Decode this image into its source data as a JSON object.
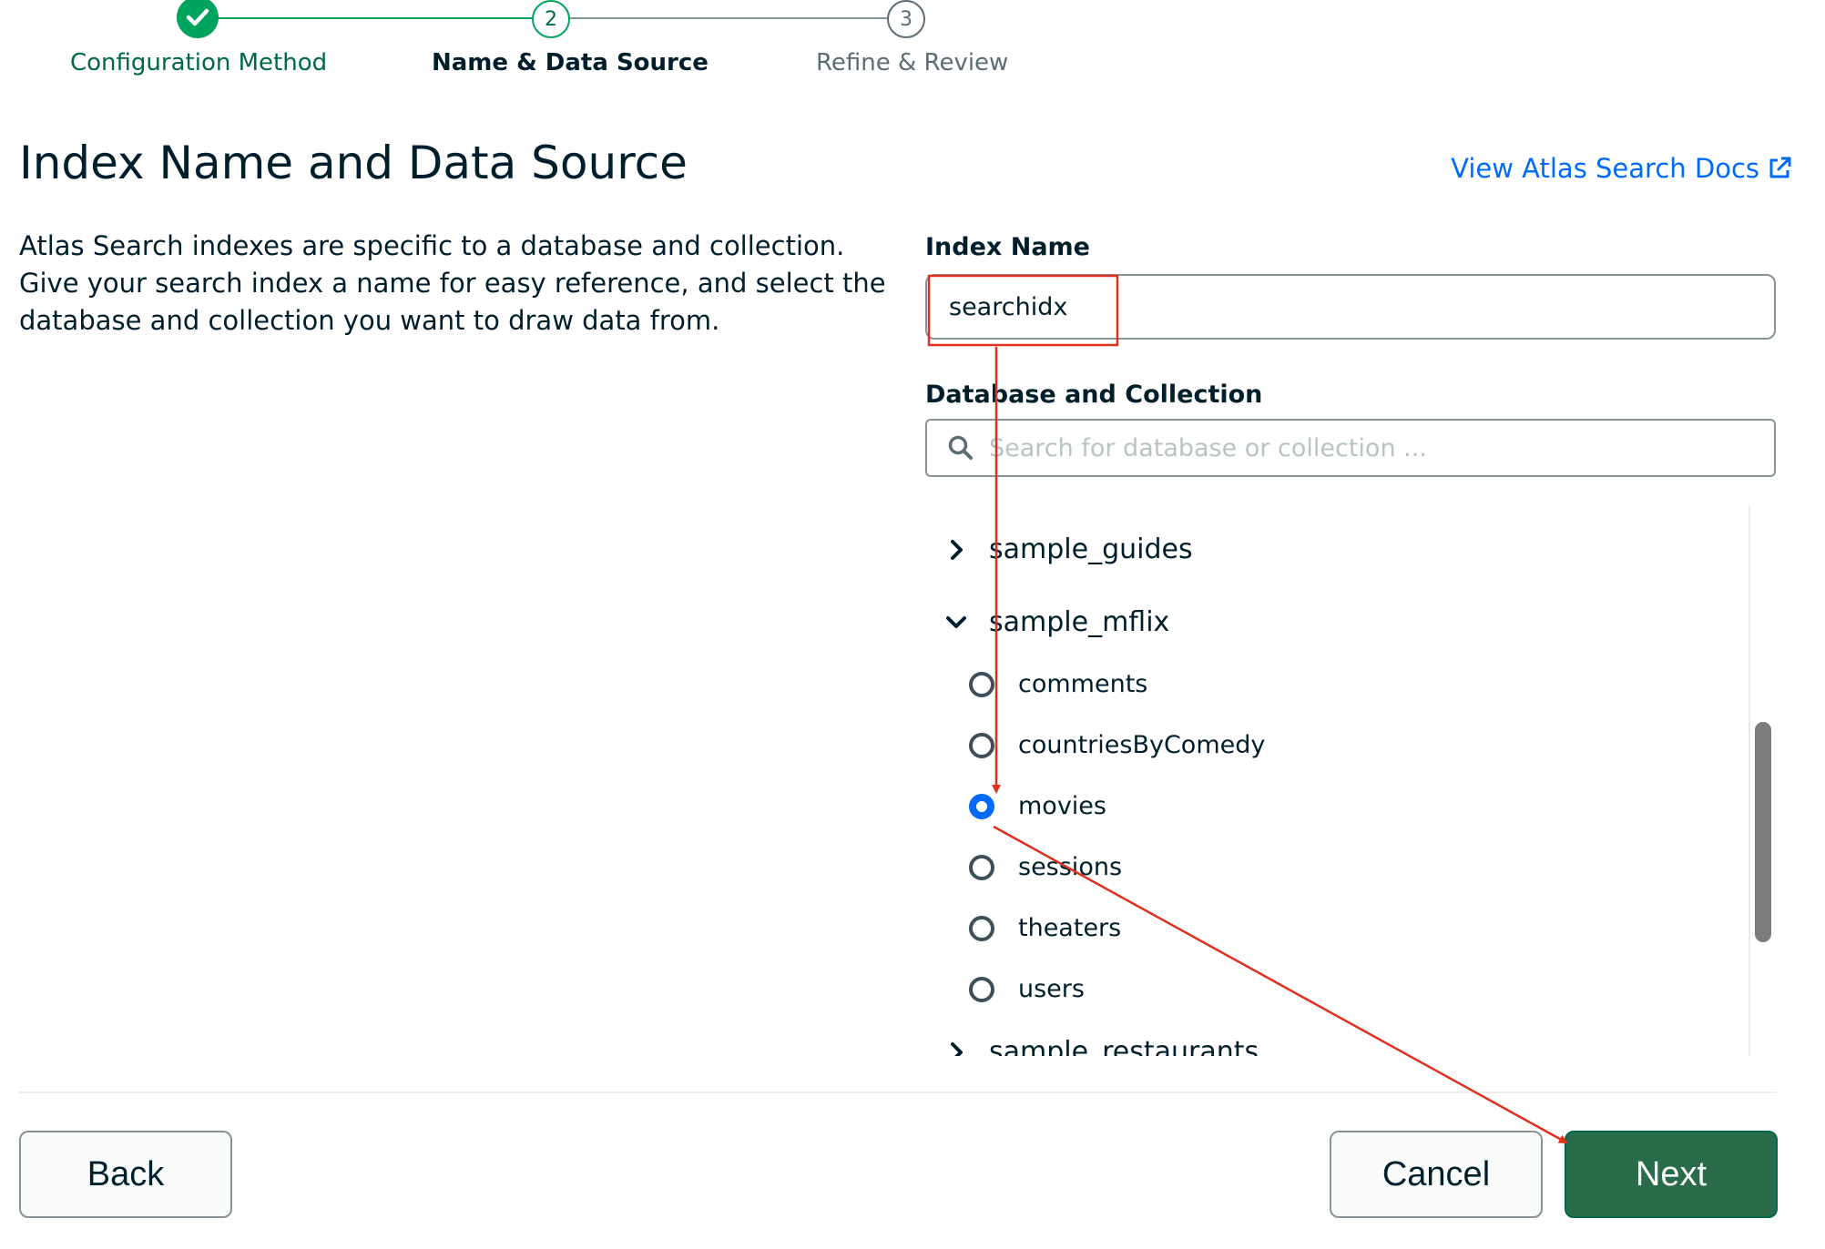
{
  "stepper": {
    "steps": [
      {
        "number": "1",
        "label": "Configuration Method",
        "state": "complete"
      },
      {
        "number": "2",
        "label": "Name & Data Source",
        "state": "current"
      },
      {
        "number": "3",
        "label": "Refine & Review",
        "state": "upcoming"
      }
    ]
  },
  "header": {
    "title": "Index Name and Data Source",
    "docs_link": "View Atlas Search Docs"
  },
  "description": "Atlas Search indexes are specific to a database and collection. Give your search index a name for easy reference, and select the database and collection you want to draw data from.",
  "index_name": {
    "label": "Index Name",
    "value": "searchidx"
  },
  "db_collection": {
    "label": "Database and Collection",
    "search_placeholder": "Search for database or collection ...",
    "databases": [
      {
        "name": "sample_guides",
        "expanded": false
      },
      {
        "name": "sample_mflix",
        "expanded": true,
        "collections": [
          "comments",
          "countriesByComedy",
          "movies",
          "sessions",
          "theaters",
          "users"
        ],
        "selected": "movies"
      },
      {
        "name": "sample_restaurants",
        "expanded": false
      }
    ]
  },
  "footer": {
    "back": "Back",
    "cancel": "Cancel",
    "next": "Next"
  },
  "colors": {
    "accent_green": "#00a35c",
    "primary_button": "#2a6b4a",
    "link_blue": "#016bf8",
    "annotation_red": "#e0301e"
  }
}
